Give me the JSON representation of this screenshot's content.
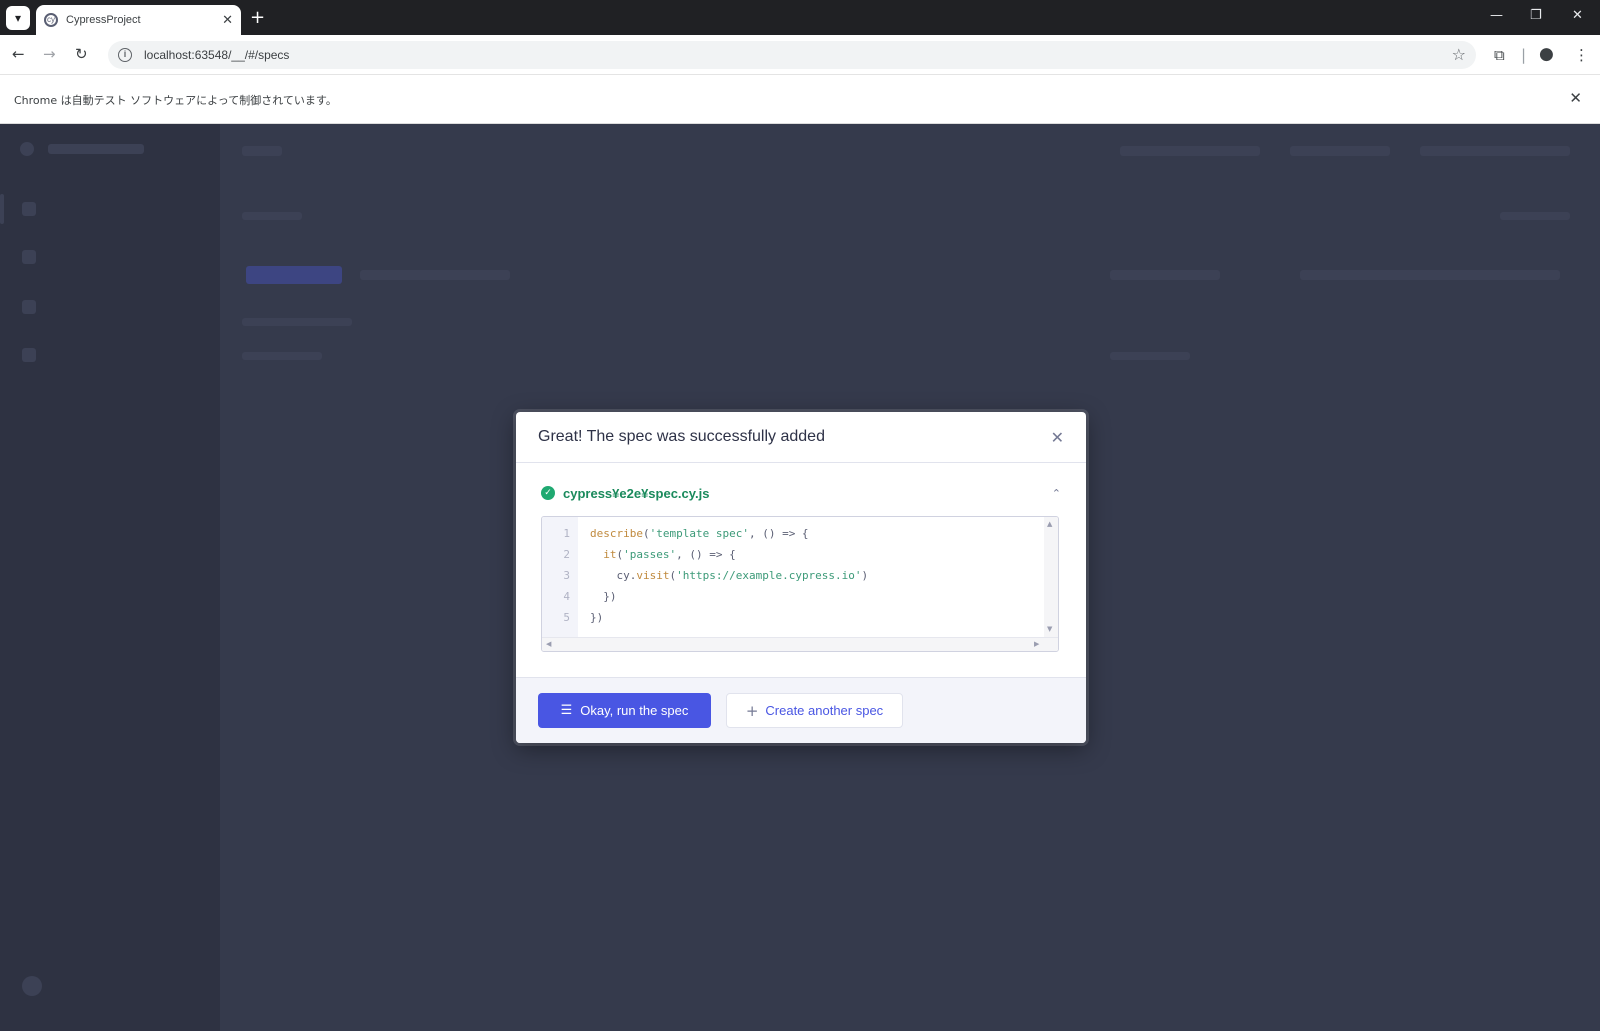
{
  "browser": {
    "tab_title": "CypressProject",
    "url": "localhost:63548/__/#/specs",
    "infobar_message": "Chrome は自動テスト ソフトウェアによって制御されています。"
  },
  "modal": {
    "title": "Great! The spec was successfully added",
    "file_path": "cypress¥e2e¥spec.cy.js",
    "code_lines": [
      {
        "n": "1",
        "parts": [
          [
            "fn",
            "describe"
          ],
          [
            "txt",
            "("
          ],
          [
            "str",
            "'template spec'"
          ],
          [
            "txt",
            ", () => {"
          ]
        ]
      },
      {
        "n": "2",
        "parts": [
          [
            "txt",
            "  "
          ],
          [
            "fn",
            "it"
          ],
          [
            "txt",
            "("
          ],
          [
            "str",
            "'passes'"
          ],
          [
            "txt",
            ", () => {"
          ]
        ]
      },
      {
        "n": "3",
        "parts": [
          [
            "txt",
            "    cy."
          ],
          [
            "fn",
            "visit"
          ],
          [
            "txt",
            "("
          ],
          [
            "str",
            "'https://example.cypress.io'"
          ],
          [
            "txt",
            ")"
          ]
        ]
      },
      {
        "n": "4",
        "parts": [
          [
            "txt",
            "  })"
          ]
        ]
      },
      {
        "n": "5",
        "parts": [
          [
            "txt",
            "})"
          ]
        ]
      }
    ],
    "primary_button": "Okay, run the spec",
    "secondary_button": "Create another spec"
  },
  "icons": {
    "tab_menu": "chevron-down-icon",
    "favicon": "cypress-icon",
    "success": "check-circle-icon",
    "collapse": "chevron-up-icon",
    "run": "list-run-icon",
    "add": "plus-icon"
  },
  "colors": {
    "primary": "#4956e3",
    "success": "#1fa971",
    "overlay": "#353a4c"
  }
}
